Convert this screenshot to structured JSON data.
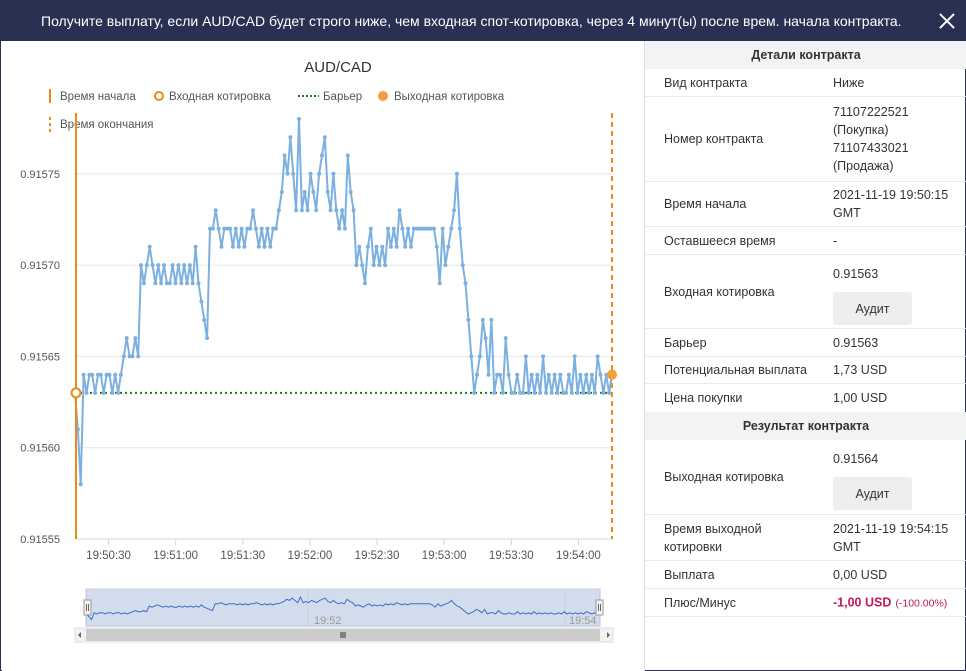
{
  "header": {
    "title": "Получите выплату, если AUD/CAD будет строго ниже, чем входная спот-котировка, через 4 минут(ы) после врем. начала контракта."
  },
  "chart": {
    "title": "AUD/CAD",
    "legend": {
      "start_time": "Время начала",
      "entry_spot": "Входная котировка",
      "barrier": "Барьер",
      "exit_spot": "Выходная котировка",
      "end_time": "Время окончания"
    },
    "navigator_labels": [
      "19:52",
      "19:54"
    ],
    "colors": {
      "line": "#7cb0e0",
      "start": "#e98a1a",
      "barrier": "#1a7a1a",
      "grid": "#e6e6e6"
    }
  },
  "chart_data": {
    "type": "line",
    "title": "AUD/CAD",
    "x_ticks": [
      "19:50:30",
      "19:51:00",
      "19:51:30",
      "19:52:00",
      "19:52:30",
      "19:53:00",
      "19:53:30",
      "19:54:00"
    ],
    "y_ticks": [
      "0.91555",
      "0.91560",
      "0.91565",
      "0.91570",
      "0.91575"
    ],
    "ylim": [
      0.91555,
      0.91578
    ],
    "xlim": [
      "19:50:15",
      "19:54:15"
    ],
    "entry_spot": 0.91563,
    "exit_spot": 0.91564,
    "barrier": 0.91563,
    "start_time": "19:50:15",
    "end_time": "19:54:15",
    "series": [
      {
        "values": [
          0.91563,
          0.91561,
          0.91558,
          0.91564,
          0.91563,
          0.91564,
          0.91564,
          0.91563,
          0.91564,
          0.91564,
          0.91563,
          0.91564,
          0.91564,
          0.91563,
          0.91564,
          0.91563,
          0.91564,
          0.91565,
          0.91566,
          0.91565,
          0.91565,
          0.91566,
          0.91565,
          0.9157,
          0.91569,
          0.9157,
          0.91571,
          0.9157,
          0.91569,
          0.9157,
          0.91569,
          0.9157,
          0.91569,
          0.91569,
          0.9157,
          0.91569,
          0.9157,
          0.91569,
          0.9157,
          0.91569,
          0.9157,
          0.91569,
          0.91571,
          0.91569,
          0.91568,
          0.91567,
          0.91566,
          0.91572,
          0.91572,
          0.91573,
          0.91572,
          0.91571,
          0.91572,
          0.91572,
          0.91572,
          0.91571,
          0.91572,
          0.91571,
          0.91572,
          0.91571,
          0.91572,
          0.91572,
          0.91573,
          0.91572,
          0.91571,
          0.91572,
          0.91571,
          0.91572,
          0.91571,
          0.91572,
          0.91572,
          0.91573,
          0.91574,
          0.91576,
          0.91575,
          0.91577,
          0.91575,
          0.91573,
          0.91578,
          0.91573,
          0.91574,
          0.91573,
          0.91575,
          0.91574,
          0.91573,
          0.91575,
          0.91576,
          0.91577,
          0.91574,
          0.91573,
          0.91575,
          0.91573,
          0.91572,
          0.91573,
          0.91572,
          0.91576,
          0.91574,
          0.91573,
          0.9157,
          0.91571,
          0.9157,
          0.91569,
          0.91571,
          0.91572,
          0.9157,
          0.91571,
          0.9157,
          0.91571,
          0.9157,
          0.91572,
          0.91571,
          0.91572,
          0.91571,
          0.91573,
          0.91572,
          0.91571,
          0.91572,
          0.91571,
          0.91572,
          0.91572,
          0.91572,
          0.91572,
          0.91572,
          0.91572,
          0.91572,
          0.91572,
          0.91571,
          0.91569,
          0.91572,
          0.9157,
          0.91571,
          0.91572,
          0.91573,
          0.91575,
          0.91572,
          0.9157,
          0.91569,
          0.91567,
          0.91565,
          0.91563,
          0.91564,
          0.91565,
          0.91567,
          0.91566,
          0.91564,
          0.91567,
          0.91563,
          0.91564,
          0.91564,
          0.91563,
          0.91566,
          0.91564,
          0.91563,
          0.91563,
          0.91564,
          0.91563,
          0.91563,
          0.91565,
          0.91563,
          0.91564,
          0.91563,
          0.91564,
          0.91563,
          0.91565,
          0.91563,
          0.91564,
          0.91563,
          0.91564,
          0.91563,
          0.91564,
          0.91563,
          0.91563,
          0.91564,
          0.91563,
          0.91565,
          0.91563,
          0.91564,
          0.91563,
          0.91564,
          0.91563,
          0.91564,
          0.91563,
          0.91565,
          0.91564,
          0.91563,
          0.91564,
          0.91563,
          0.91564
        ]
      }
    ]
  },
  "contract_details": {
    "header": "Детали контракта",
    "rows": [
      {
        "label": "Вид контракта",
        "value": "Ниже"
      },
      {
        "label": "Номер контракта",
        "value_lines": [
          "71107222521",
          "(Покупка)",
          "71107433021",
          "(Продажа)"
        ]
      },
      {
        "label": "Время начала",
        "value_lines": [
          "2021-11-19 19:50:15",
          "GMT"
        ]
      },
      {
        "label": "Оставшееся время",
        "value": "-"
      },
      {
        "label": "Входная котировка",
        "value": "0.91563",
        "button": "Аудит"
      },
      {
        "label": "Барьер",
        "value": "0.91563"
      },
      {
        "label": "Потенциальная выплата",
        "value": "1,73 USD"
      },
      {
        "label": "Цена покупки",
        "value": "1,00 USD"
      }
    ]
  },
  "contract_result": {
    "header": "Результат контракта",
    "rows": [
      {
        "label": "Выходная котировка",
        "value": "0.91564",
        "button": "Аудит"
      },
      {
        "label_lines": [
          "Время выходной",
          "котировки"
        ],
        "value_lines": [
          "2021-11-19 19:54:15",
          "GMT"
        ]
      },
      {
        "label": "Выплата",
        "value": "0,00 USD"
      },
      {
        "label": "Плюс/Минус",
        "value": "-1,00 USD",
        "extra": "(-100.00%)"
      }
    ]
  }
}
